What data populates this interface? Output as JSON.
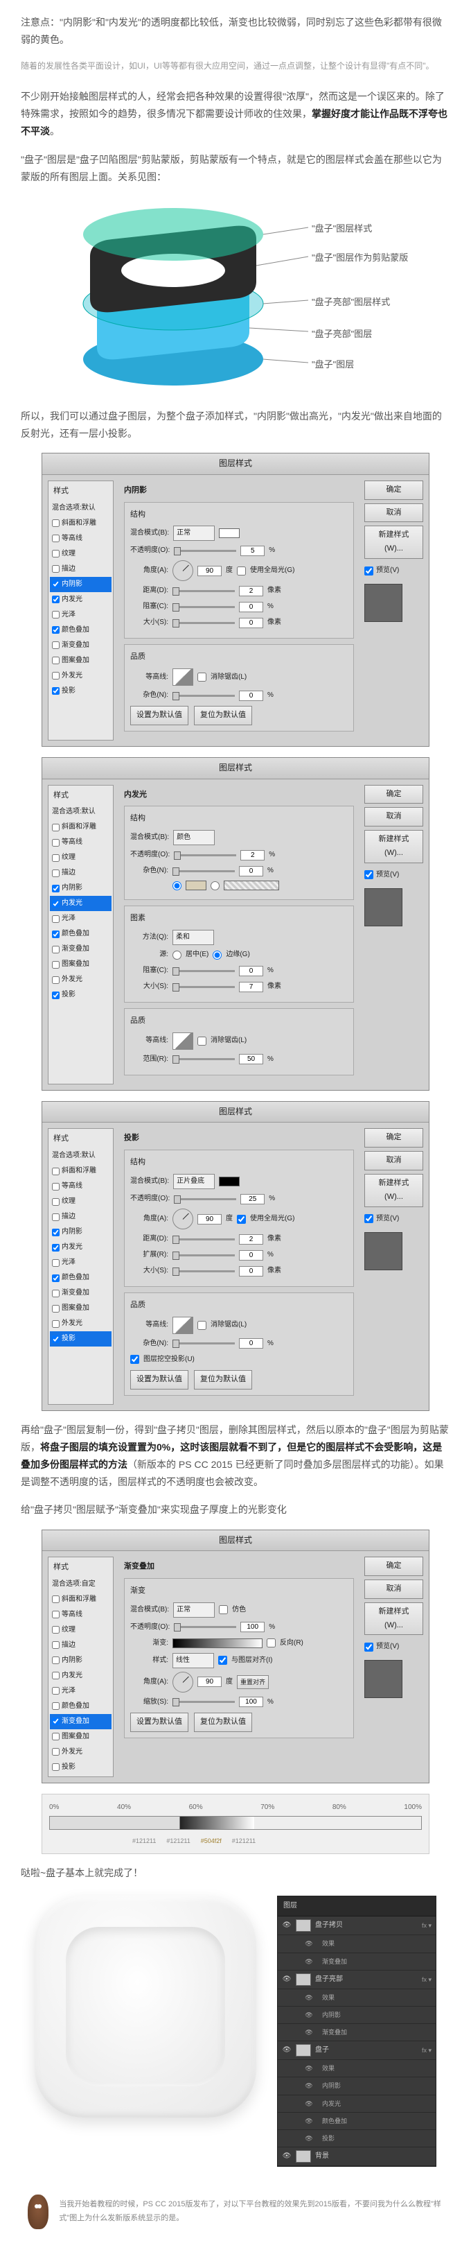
{
  "intro_note": "注意点：\"内阴影\"和\"内发光\"的透明度都比较低，渐变也比较微弱，同时别忘了这些色彩都带有很微弱的黄色。",
  "subtle_hint": "随着的发展性各类平面设计，如UI，UI等等都有很大应用空间，通过一点点调整，让整个设计有显得\"有点不同\"。",
  "para1_pre": "不少刚开始接触图层样式的人，经常会把各种效果的设置得很\"浓厚\"，然而这是一个误区来的。除了特殊需求，按照如今的趋势，很多情况下都需要设计师收的住效果，",
  "para1_bold": "掌握好度才能让作品既不浮夸也不平淡",
  "para1_post": "。",
  "para2": "\"盘子\"图层是\"盘子凹陷图层\"剪贴蒙版，剪贴蒙版有一个特点，就是它的图层样式会盖在那些以它为蒙版的所有图层上面。关系见图：",
  "diagram_labels": {
    "l1": "\"盘子\"图层样式",
    "l2": "\"盘子\"图层作为剪贴蒙版",
    "l3": "\"盘子亮部\"图层样式",
    "l4": "\"盘子亮部\"图层",
    "l5": "\"盘子\"图层"
  },
  "para3": "所以，我们可以通过盘子图层，为整个盘子添加样式，\"内阴影\"做出高光，\"内发光\"做出来自地面的反射光，还有一层小投影。",
  "ps_dialog_title": "图层样式",
  "styles_list_label": "样式",
  "styles": {
    "blend_default": "混合选项:默认",
    "bevel": "斜面和浮雕",
    "contour": "等高线",
    "texture": "纹理",
    "stroke": "描边",
    "inner_shadow": "内阴影",
    "inner_glow": "内发光",
    "satin": "光泽",
    "color_overlay": "颜色叠加",
    "gradient_overlay": "渐变叠加",
    "pattern_overlay": "图案叠加",
    "outer_glow": "外发光",
    "drop_shadow": "投影"
  },
  "styles_custom": "混合选项:自定",
  "labels": {
    "structure": "结构",
    "blend_mode": "混合模式(B):",
    "opacity": "不透明度(O):",
    "angle": "角度(A):",
    "distance": "距离(D):",
    "spread": "扩展(R):",
    "choke": "阻塞(C):",
    "size": "大小(S):",
    "elements": "图素",
    "method": "方法(Q):",
    "source": "源:",
    "quality": "品质",
    "contour_l": "等高线:",
    "noise": "杂色(N):",
    "gradient": "渐变:",
    "style": "样式:",
    "scale": "缩放(S):",
    "range": "范围(R):",
    "center": "居中(E)",
    "edge": "边缘(G)",
    "use_global": "使用全局光(G)",
    "anti_alias": "消除锯齿(L)",
    "reverse": "反向(R)",
    "dither": "仿色",
    "align": "与图层对齐(I)",
    "knockout": "图层挖空投影(U)",
    "reset_default": "设置为默认值",
    "reset_to_default": "复位为默认值",
    "make_default": "设为默认值",
    "pct": "%",
    "deg": "度",
    "px": "像素"
  },
  "modes": {
    "normal": "正常",
    "multiply": "正片叠底",
    "color": "颜色",
    "soft": "柔和",
    "linear": "线性"
  },
  "sections": {
    "inner_shadow": "内阴影",
    "inner_glow": "内发光",
    "drop_shadow": "投影",
    "gradient_overlay": "渐变叠加",
    "gradient": "渐变"
  },
  "buttons": {
    "ok": "确定",
    "cancel": "取消",
    "new_style": "新建样式(W)...",
    "preview": "预览(V)"
  },
  "values": {
    "d1_opacity": "5",
    "d1_angle": "90",
    "d1_distance": "2",
    "d1_spread": "0",
    "d1_size": "0",
    "d1_noise": "0",
    "d2_opacity": "2",
    "d2_noise": "0",
    "d2_choke": "0",
    "d2_size": "7",
    "d2_range": "50",
    "d3_opacity": "25",
    "d3_angle": "90",
    "d3_distance": "2",
    "d3_spread": "0",
    "d3_size": "0",
    "d3_noise": "0",
    "d4_opacity": "100",
    "d4_angle": "90",
    "d4_scale": "100",
    "zero": "0"
  },
  "para4_pre": "再给\"盘子\"图层复制一份，得到\"盘子拷贝\"图层，删除其图层样式，然后以原本的\"盘子\"图层为剪贴蒙版，",
  "para4_bold1": "将盘子图层的填充设置置为0%，这时该图层就看不到了，但是它的图层样式不会受影响，这是叠加多份图层样式的方法",
  "para4_mid": "（新版本的 PS CC 2015 已经更新了同时叠加多层图层样式的功能）。如果是调整不透明度的话，图层样式的不透明度也会被改变。",
  "para5": "给\"盘子拷贝\"图层赋予\"渐变叠加\"来实现盘子厚度上的光影变化",
  "gradient_scale": [
    "0%",
    "40%",
    "60%",
    "70%",
    "80%",
    "100%"
  ],
  "gradient_stops": [
    "#121211",
    "#121211",
    "#504f2f",
    "#121211"
  ],
  "complete": "哒啦~盘子基本上就完成了！",
  "layers_panel": {
    "header": "图层",
    "items": [
      {
        "name": "盘子拷贝",
        "fx": true
      },
      {
        "effect": "效果"
      },
      {
        "effect": "渐变叠加"
      },
      {
        "name": "盘子亮部",
        "fx": true
      },
      {
        "effect": "效果"
      },
      {
        "effect": "内阴影"
      },
      {
        "effect": "渐变叠加"
      },
      {
        "name": "盘子",
        "fx": true
      },
      {
        "effect": "效果"
      },
      {
        "effect": "内阴影"
      },
      {
        "effect": "内发光"
      },
      {
        "effect": "颜色叠加"
      },
      {
        "effect": "投影"
      },
      {
        "name": "背景"
      }
    ]
  },
  "author": "当我开始着教程的时候，PS CC 2015版发布了，对以下平台教程的效果先到2015版看，不要问我为什么么教程\"样式\"图上为什么发新版系统显示的是。"
}
